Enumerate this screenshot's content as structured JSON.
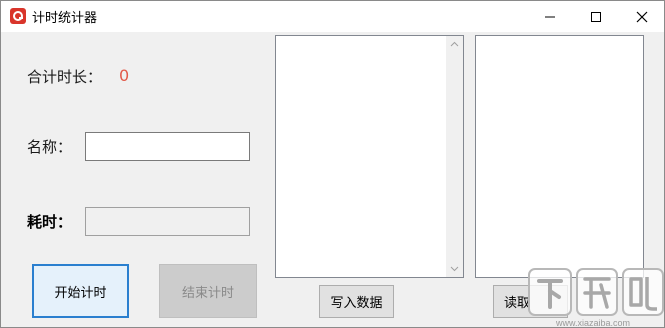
{
  "window": {
    "title": "计时统计器",
    "icon": "stopwatch-app-icon",
    "controls": [
      "minimize-icon",
      "maximize-icon",
      "close-icon"
    ]
  },
  "form": {
    "total_label": "合计时长：",
    "total_value": "0",
    "name_label": "名称：",
    "name_value": "",
    "elapsed_label": "耗时：",
    "elapsed_value": ""
  },
  "buttons": {
    "start": "开始计时",
    "stop": "结束计时",
    "write": "写入数据",
    "read": "读取"
  },
  "colors": {
    "accent_red": "#e25a4a",
    "focus_blue": "#2a7fcf",
    "app_icon": "#d9352b"
  },
  "watermark": {
    "brand": "下载吧",
    "url": "www.xiazaiba.com"
  }
}
